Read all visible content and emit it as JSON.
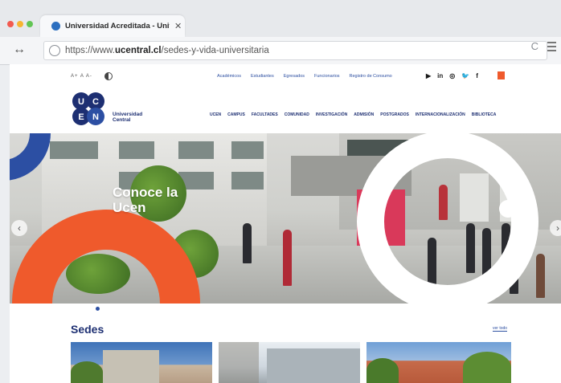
{
  "browser": {
    "tab_title": "Universidad Acreditada - Univ",
    "tab_close": "✕",
    "nav_arrows": "↔",
    "url_prefix": "https://www.",
    "url_domain": "ucentral.cl",
    "url_path": "/sedes-y-vida-universitaria",
    "reload_icon": "C",
    "traffic_colors": [
      "#f25a4f",
      "#f7b531",
      "#62c554"
    ]
  },
  "site": {
    "font_controls": "A+  A  A-",
    "top_links": [
      "Académicos",
      "Estudiantes",
      "Egresados",
      "Funcionarios",
      "Registro de Consumo"
    ],
    "socials": [
      "▶",
      "in",
      "◎",
      "🐦",
      "f"
    ],
    "logo": {
      "initials": [
        "U",
        "C",
        "E",
        "N"
      ],
      "name_line1": "Universidad",
      "name_line2": "Central"
    },
    "main_nav": [
      "UCEN",
      "CAMPUS",
      "FACULTADES",
      "COMUNIDAD",
      "INVESTIGACIÓN",
      "ADMISIÓN",
      "POSTGRADOS",
      "INTERNACIONALIZACIÓN",
      "BIBLIOTECA"
    ],
    "hero": {
      "title_line1": "Conoce la",
      "title_line2": "Ucen",
      "prev": "‹",
      "next": "›"
    },
    "sedes": {
      "title": "Sedes",
      "link": "ver todo"
    },
    "colors": {
      "brand_blue": "#1d2f72",
      "accent_orange": "#ef5a2c",
      "link_blue": "#2d4fa1"
    }
  }
}
